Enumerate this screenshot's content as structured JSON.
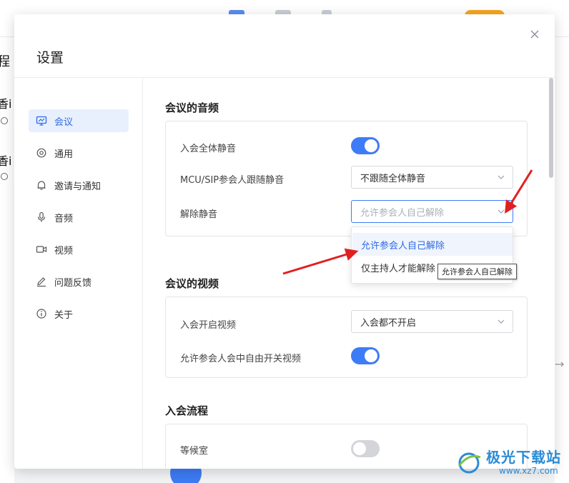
{
  "background": {
    "left_title": "程",
    "left_item_1": "香i",
    "left_item_2": "香i"
  },
  "dialog": {
    "title": "设置"
  },
  "sidebar": {
    "items": [
      {
        "label": "会议",
        "icon": "presentation-icon",
        "active": true
      },
      {
        "label": "通用",
        "icon": "gear-icon",
        "active": false
      },
      {
        "label": "邀请与通知",
        "icon": "bell-icon",
        "active": false
      },
      {
        "label": "音频",
        "icon": "microphone-icon",
        "active": false
      },
      {
        "label": "视频",
        "icon": "video-camera-icon",
        "active": false
      },
      {
        "label": "问题反馈",
        "icon": "pencil-icon",
        "active": false
      },
      {
        "label": "关于",
        "icon": "info-icon",
        "active": false
      }
    ]
  },
  "audio": {
    "title": "会议的音频",
    "mute_all_label": "入会全体静音",
    "mute_all_on": true,
    "mcu_label": "MCU/SIP参会人跟随静音",
    "mcu_value": "不跟随全体静音",
    "unmute_label": "解除静音",
    "unmute_value": "允许参会人自己解除"
  },
  "dropdown": {
    "options": [
      "允许参会人自己解除",
      "仅主持人才能解除"
    ],
    "tooltip": "允许参会人自己解除"
  },
  "video": {
    "title": "会议的视频",
    "start_video_label": "入会开启视频",
    "start_video_value": "入会都不开启",
    "free_toggle_label": "允许参会人会中自由开关视频",
    "free_toggle_on": true
  },
  "join_flow": {
    "title": "入会流程",
    "waiting_room_label": "等候室",
    "waiting_room_on": false
  },
  "watermark": {
    "title": "极光下载站",
    "url": "www.xz7.com"
  },
  "colors": {
    "accent": "#3e7bf6",
    "annotation_red": "#e02020"
  }
}
